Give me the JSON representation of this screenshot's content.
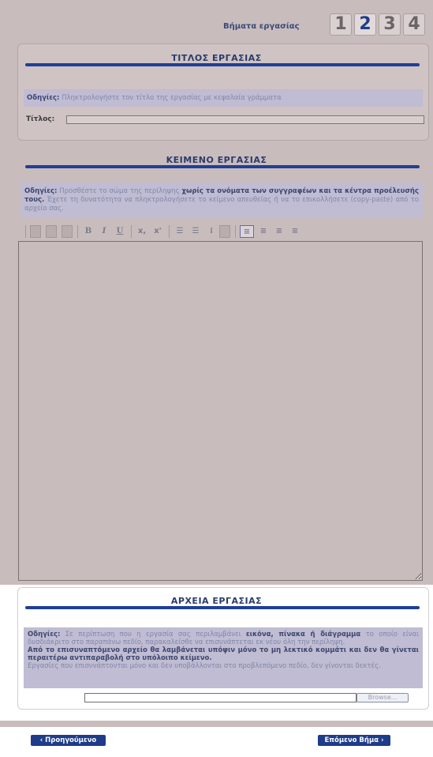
{
  "steps": {
    "label": "Βήματα εργασίας",
    "items": [
      "1",
      "2",
      "3",
      "4"
    ],
    "current": "2"
  },
  "title_section": {
    "heading": "ΤΙΤΛΟΣ ΕΡΓΑΣΙΑΣ",
    "instructions_key": "Οδηγίες:",
    "instructions_text": "Πληκτρολογήστε τον τίτλο της εργασίας με κεφαλαία γράμματα",
    "field_label": "Τίτλος:",
    "field_value": ""
  },
  "text_section": {
    "heading": "ΚΕΙΜΕΝΟ ΕΡΓΑΣΙΑΣ",
    "instructions_key": "Οδηγίες:",
    "instructions_pre": "Προσθέστε το σώμα της περίληψης",
    "instructions_bold": "χωρίς τα ονόματα των συγγραφέων και τα κέντρα προέλευσής τους.",
    "instructions_post": "Έχετε τη δυνατότητα να πληκτρολογήσετε το κείμενο απευθείας ή να το επικολλήσετε (copy-paste) από το αρχείο σας.",
    "toolbar": {
      "bold": "B",
      "italic": "I",
      "underline": "U",
      "subscript": "x,",
      "superscript": "x'"
    },
    "editor_value": ""
  },
  "files_section": {
    "heading": "ΑΡΧΕΙΑ ΕΡΓΑΣΙΑΣ",
    "instructions_key": "Οδηγίες:",
    "p1_pre": "Σε περίπτωση που η εργασία σας περιλαμβάνει",
    "p1_bold": "εικόνα, πίνακα ή διάγραμμα",
    "p1_post": "το οποίο είναι δυσδιάκριτο στο παραπάνω πεδίο, παρακαλείσθε να επισυνάπτεται εκ νέου όλη την περίληψη.",
    "p2_bold": "Από το επισυναπτόμενο αρχείο θα λαμβάνεται υπόψιν μόνο το μη λεκτικό κομμάτι και δεν θα γίνεται περαιτέρω αντιπαραβολή στο υπόλοιπο κείμενο.",
    "p3": "Εργασίες που επισυνάπτονται μόνο και δεν υποβάλλονται στο προβλεπόμενο πεδίο, δεν γίνονται δεκτές.",
    "file_value": "",
    "browse_label": "Browse..."
  },
  "nav": {
    "prev_label": "‹ Προηγούμενο Βήμα",
    "next_label": "Επόμενο Βήμα ›"
  },
  "colors": {
    "accent": "#1f3f96",
    "panel_bg": "#cfc3c3",
    "button_bg": "#1e3c8a"
  }
}
